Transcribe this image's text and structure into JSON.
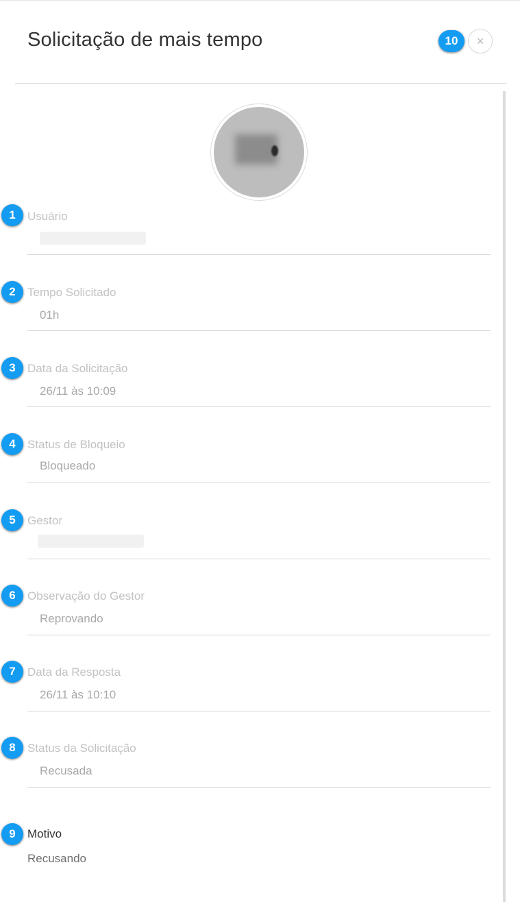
{
  "header": {
    "title": "Solicitação de mais tempo",
    "close_icon": "close-icon",
    "close_glyph": "×"
  },
  "avatar": {
    "icon": "user-avatar"
  },
  "annotation_color": "#139cf2",
  "fields": [
    {
      "badge": "1",
      "label": "Usuário",
      "value": "",
      "redacted": true
    },
    {
      "badge": "2",
      "label": "Tempo Solicitado",
      "value": "01h"
    },
    {
      "badge": "3",
      "label": "Data da Solicitação",
      "value": "26/11 às 10:09"
    },
    {
      "badge": "4",
      "label": "Status de Bloqueio",
      "value": "Bloqueado"
    },
    {
      "badge": "5",
      "label": "Gestor",
      "value": "",
      "redacted": true
    },
    {
      "badge": "6",
      "label": "Observação do Gestor",
      "value": "Reprovando"
    },
    {
      "badge": "7",
      "label": "Data da Resposta",
      "value": "26/11 às 10:10"
    },
    {
      "badge": "8",
      "label": "Status da Solicitação",
      "value": "Recusada"
    }
  ],
  "motivo": {
    "badge": "9",
    "label": "Motivo",
    "value": "Recusando"
  },
  "close_badge": "10"
}
